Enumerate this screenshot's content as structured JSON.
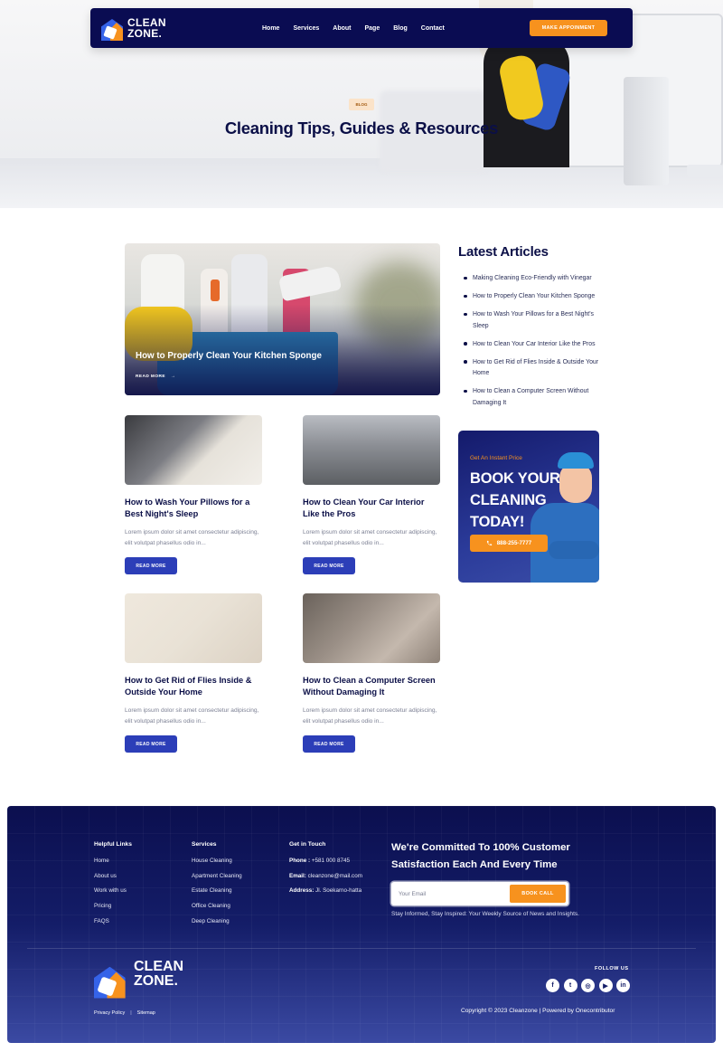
{
  "brand": {
    "name_line1": "CLEAN",
    "name_line2": "ZONE."
  },
  "nav": {
    "links": [
      "Home",
      "Services",
      "About",
      "Page",
      "Blog",
      "Contact"
    ],
    "cta": "MAKE APPOINMENT"
  },
  "hero": {
    "badge": "BLOG",
    "title": "Cleaning Tips, Guides & Resources"
  },
  "featured": {
    "title": "How to Properly Clean Your Kitchen Sponge",
    "read_more": "READ MORE",
    "arrow": "→"
  },
  "posts": [
    {
      "title": "How to Wash Your Pillows for a Best Night's Sleep",
      "excerpt": "Lorem ipsum dolor sit amet consectetur adipiscing, elit volutpat phasellus odio in...",
      "button": "READ MORE"
    },
    {
      "title": "How to Clean Your Car Interior Like the Pros",
      "excerpt": "Lorem ipsum dolor sit amet consectetur adipiscing, elit volutpat phasellus odio in...",
      "button": "READ MORE"
    },
    {
      "title": "How to Get Rid of Flies Inside & Outside Your Home",
      "excerpt": "Lorem ipsum dolor sit amet consectetur adipiscing, elit volutpat phasellus odio in...",
      "button": "READ MORE"
    },
    {
      "title": "How to Clean a Computer Screen Without Damaging It",
      "excerpt": "Lorem ipsum dolor sit amet consectetur adipiscing, elit volutpat phasellus odio in...",
      "button": "READ MORE"
    }
  ],
  "sidebar": {
    "title": "Latest Articles",
    "articles": [
      "Making Cleaning Eco-Friendly with Vinegar",
      "How to Properly Clean Your Kitchen Sponge",
      "How to Wash Your Pillows for a Best Night's Sleep",
      "How to Clean Your Car Interior Like the Pros",
      "How to Get Rid of Flies Inside & Outside Your Home",
      "How to Clean a Computer Screen Without Damaging It"
    ],
    "promo": {
      "subtitle": "Get An Instant Price",
      "headline": "BOOK YOUR CLEANING TODAY!",
      "phone": "888-255-7777",
      "phone_icon": "phone-icon"
    }
  },
  "footer": {
    "helpful": {
      "heading": "Helpful Links",
      "items": [
        "Home",
        "About us",
        "Work with us",
        "Pricing",
        "FAQS"
      ]
    },
    "services": {
      "heading": "Services",
      "items": [
        "House Cleaning",
        "Apartment Cleaning",
        "Estate Cleaning",
        "Office Cleaning",
        "Deep Cleaning"
      ]
    },
    "contact": {
      "heading": "Get in Touch",
      "phone_label": "Phone :",
      "phone": " +581 000 8745",
      "email_label": "Email:",
      "email": " cleanzone@mail.com",
      "address_label": "Address:",
      "address": " Jl. Soekarno-hatta"
    },
    "commit": "We're Committed To 100% Customer Satisfaction Each And Every Time",
    "email_placeholder": "Your Email",
    "book_button": "BOOK CALL",
    "note": "Stay Informed, Stay Inspired: Your Weekly Source of News and Insights.",
    "follow_label": "FOLLOW US",
    "socials": [
      "f",
      "t",
      "◎",
      "▶",
      "in"
    ],
    "privacy": "Privacy Policy",
    "separator": "|",
    "sitemap": "Sitemap",
    "copyright": "Copyright © 2023 Cleanzone | Powered by Onecontributor"
  },
  "colors": {
    "navy": "#0b0f47",
    "orange": "#f7921e",
    "button_blue": "#2c3eb8"
  }
}
